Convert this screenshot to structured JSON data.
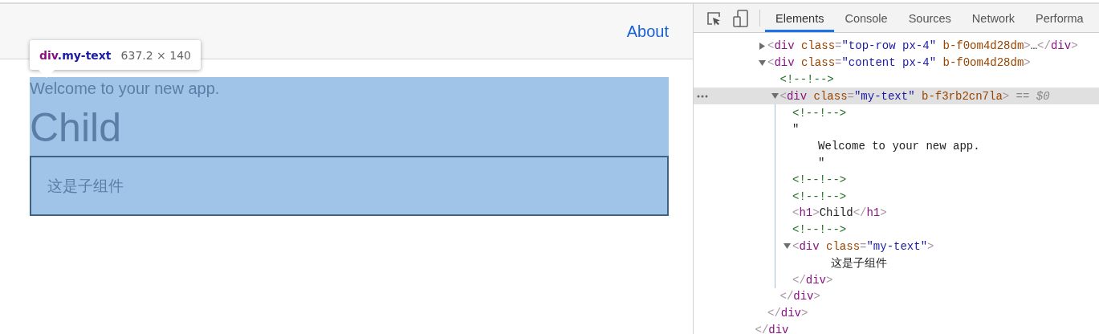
{
  "page": {
    "nav_link": "About",
    "inspect_tooltip": {
      "tag": "div",
      "class_name": ".my-text",
      "size": "637.2 × 140"
    },
    "content": {
      "welcome": "Welcome to your new app.",
      "heading": "Child",
      "child_text": "这是子组件"
    }
  },
  "devtools": {
    "tabs": [
      {
        "label": "Elements",
        "selected": true
      },
      {
        "label": "Console",
        "selected": false
      },
      {
        "label": "Sources",
        "selected": false
      },
      {
        "label": "Network",
        "selected": false
      },
      {
        "label": "Performa",
        "selected": false
      }
    ],
    "dom_tree": [
      {
        "kind": "element",
        "close": [
          {
            "kind": "punct",
            "text": "</"
          },
          {
            "kind": "tag",
            "text": "div"
          }
        ],
        "children": [
          {
            "kind": "element",
            "expanded": false,
            "selected": false,
            "open": [
              {
                "kind": "punct",
                "text": "<"
              },
              {
                "kind": "tag",
                "text": "div"
              },
              {
                "kind": "attr",
                "text": " class"
              },
              {
                "kind": "punct",
                "text": "="
              },
              {
                "kind": "value",
                "text": "\"top-row px-4\""
              },
              {
                "kind": "attr",
                "text": " b-f0om4d28dm"
              },
              {
                "kind": "punct",
                "text": ">"
              },
              {
                "kind": "text",
                "text": "…"
              },
              {
                "kind": "punct",
                "text": "</"
              },
              {
                "kind": "tag",
                "text": "div"
              },
              {
                "kind": "punct",
                "text": ">"
              }
            ]
          },
          {
            "kind": "element",
            "expanded": true,
            "selected": false,
            "open": [
              {
                "kind": "punct",
                "text": "<"
              },
              {
                "kind": "tag",
                "text": "div"
              },
              {
                "kind": "attr",
                "text": " class"
              },
              {
                "kind": "punct",
                "text": "="
              },
              {
                "kind": "value",
                "text": "\"content px-4\""
              },
              {
                "kind": "attr",
                "text": " b-f0om4d28dm"
              },
              {
                "kind": "punct",
                "text": ">"
              }
            ],
            "close": [
              {
                "kind": "punct",
                "text": "</"
              },
              {
                "kind": "tag",
                "text": "div"
              },
              {
                "kind": "punct",
                "text": ">"
              }
            ],
            "children": [
              {
                "kind": "comment",
                "text": "<!--!-->"
              },
              {
                "kind": "element",
                "expanded": true,
                "selected": true,
                "open": [
                  {
                    "kind": "punct",
                    "text": "<"
                  },
                  {
                    "kind": "tag",
                    "text": "div"
                  },
                  {
                    "kind": "attr",
                    "text": " class"
                  },
                  {
                    "kind": "punct",
                    "text": "="
                  },
                  {
                    "kind": "value",
                    "text": "\"my-text\""
                  },
                  {
                    "kind": "attr",
                    "text": " b-f3rb2cn7la"
                  },
                  {
                    "kind": "punct",
                    "text": ">"
                  },
                  {
                    "kind": "marker",
                    "text": " == $0"
                  }
                ],
                "close": [
                  {
                    "kind": "punct",
                    "text": "</"
                  },
                  {
                    "kind": "tag",
                    "text": "div"
                  },
                  {
                    "kind": "punct",
                    "text": ">"
                  }
                ],
                "children": [
                  {
                    "kind": "comment",
                    "text": "<!--!-->"
                  },
                  {
                    "kind": "text",
                    "lines": [
                      "\"",
                      "Welcome to your new app.",
                      "\""
                    ]
                  },
                  {
                    "kind": "comment",
                    "text": "<!--!-->"
                  },
                  {
                    "kind": "comment",
                    "text": "<!--!-->"
                  },
                  {
                    "kind": "inline",
                    "tokens": [
                      {
                        "kind": "punct",
                        "text": "<"
                      },
                      {
                        "kind": "tag",
                        "text": "h1"
                      },
                      {
                        "kind": "punct",
                        "text": ">"
                      },
                      {
                        "kind": "text",
                        "text": "Child"
                      },
                      {
                        "kind": "punct",
                        "text": "</"
                      },
                      {
                        "kind": "tag",
                        "text": "h1"
                      },
                      {
                        "kind": "punct",
                        "text": ">"
                      }
                    ]
                  },
                  {
                    "kind": "comment",
                    "text": "<!--!-->"
                  },
                  {
                    "kind": "element",
                    "expanded": true,
                    "selected": false,
                    "open": [
                      {
                        "kind": "punct",
                        "text": "<"
                      },
                      {
                        "kind": "tag",
                        "text": "div"
                      },
                      {
                        "kind": "attr",
                        "text": " class"
                      },
                      {
                        "kind": "punct",
                        "text": "="
                      },
                      {
                        "kind": "value",
                        "text": "\"my-text\""
                      },
                      {
                        "kind": "punct",
                        "text": ">"
                      }
                    ],
                    "close": [
                      {
                        "kind": "punct",
                        "text": "</"
                      },
                      {
                        "kind": "tag",
                        "text": "div"
                      },
                      {
                        "kind": "punct",
                        "text": ">"
                      }
                    ],
                    "children": [
                      {
                        "kind": "text",
                        "lines": [
                          "这是子组件"
                        ]
                      }
                    ]
                  }
                ]
              }
            ]
          }
        ]
      }
    ]
  }
}
